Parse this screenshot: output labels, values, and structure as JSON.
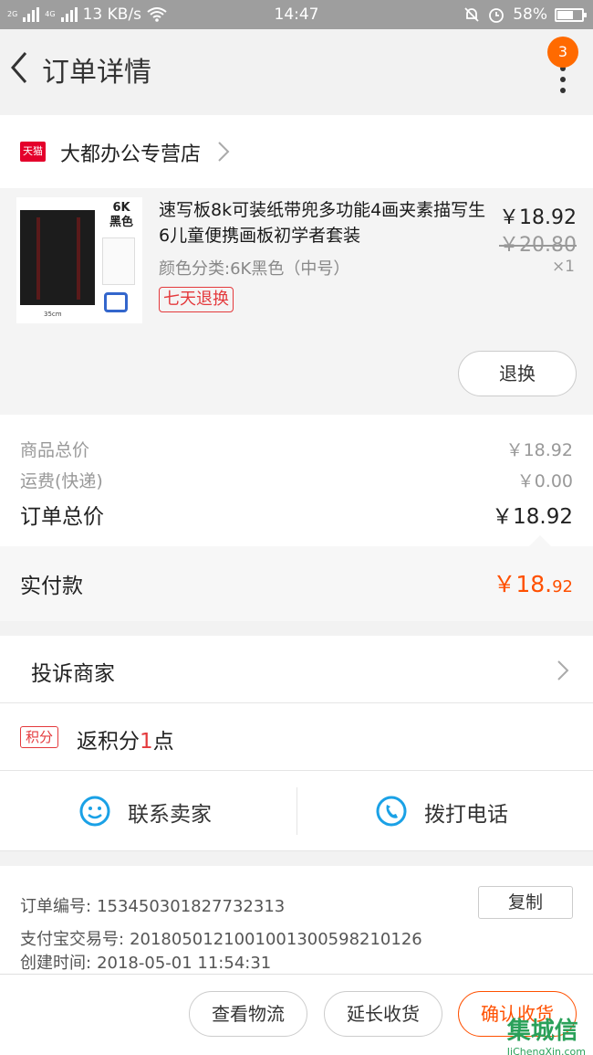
{
  "status_bar": {
    "net_2g": "2G",
    "net_4g": "4G",
    "speed": "13 KB/s",
    "time": "14:47",
    "battery": "58%"
  },
  "header": {
    "title": "订单详情",
    "badge_count": "3"
  },
  "shop": {
    "badge": "天猫",
    "name": "大都办公专营店"
  },
  "product": {
    "name": "速写板8k可装纸带兜多功能4画夹素描写生6儿童便携画板初学者套装",
    "spec": "颜色分类:6K黑色（中号）",
    "tag": "七天退换",
    "price": "￥18.92",
    "original_price": "￥20.80",
    "quantity": "×1",
    "image_label": "6K\n黑色",
    "image_dim": "35cm",
    "return_button": "退换"
  },
  "totals": {
    "goods_label": "商品总价",
    "goods_value": "￥18.92",
    "shipping_label": "运费(快递)",
    "shipping_value": "￥0.00",
    "order_label": "订单总价",
    "order_value": "￥18.92",
    "paid_label": "实付款",
    "paid_main": "￥18.",
    "paid_cents": "92"
  },
  "complaint": {
    "label": "投诉商家"
  },
  "points": {
    "tag": "积分",
    "prefix": "返积分",
    "count": "1",
    "suffix": "点"
  },
  "contact": {
    "seller": "联系卖家",
    "call": "拨打电话"
  },
  "order_info": {
    "order_no_label": "订单编号:",
    "order_no": "153450301827732313",
    "copy_button": "复制",
    "alipay_label": "支付宝交易号:",
    "alipay_no": "2018050121001001300598210126",
    "created_label": "创建时间:",
    "created_time": "2018-05-01 11:54:31"
  },
  "bottom_bar": {
    "logistics": "查看物流",
    "extend": "延长收货",
    "confirm": "确认收货"
  },
  "watermark": {
    "logo": "集城信",
    "site": "JiChengXin.com"
  },
  "colors": {
    "accent": "#ff5000",
    "tmall_red": "#e4002b",
    "link_blue": "#1aa1e6"
  }
}
